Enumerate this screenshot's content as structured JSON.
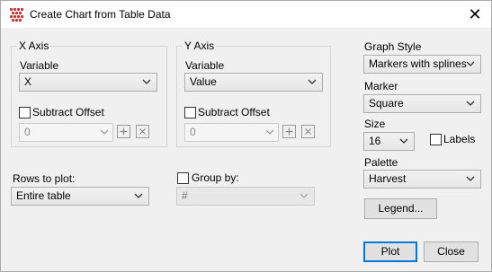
{
  "window": {
    "title": "Create Chart from Table Data",
    "close_glyph": "✕"
  },
  "x_axis": {
    "group_title": "X Axis",
    "variable_label": "Variable",
    "variable_value": "X",
    "subtract_offset_label": "Subtract Offset",
    "offset_value": "0"
  },
  "y_axis": {
    "group_title": "Y Axis",
    "variable_label": "Variable",
    "variable_value": "Value",
    "subtract_offset_label": "Subtract Offset",
    "offset_value": "0"
  },
  "rows": {
    "label": "Rows to plot:",
    "value": "Entire table"
  },
  "group_by": {
    "label": "Group by:",
    "value": "#"
  },
  "graph_style": {
    "label": "Graph Style",
    "value": "Markers with splines"
  },
  "marker": {
    "label": "Marker",
    "value": "Square"
  },
  "size": {
    "label": "Size",
    "value": "16",
    "labels_checkbox": "Labels"
  },
  "palette": {
    "label": "Palette",
    "value": "Harvest"
  },
  "buttons": {
    "legend": "Legend...",
    "plot": "Plot",
    "close": "Close"
  },
  "colors": {
    "accent": "#0078d7",
    "app_icon": "#e0262b"
  }
}
